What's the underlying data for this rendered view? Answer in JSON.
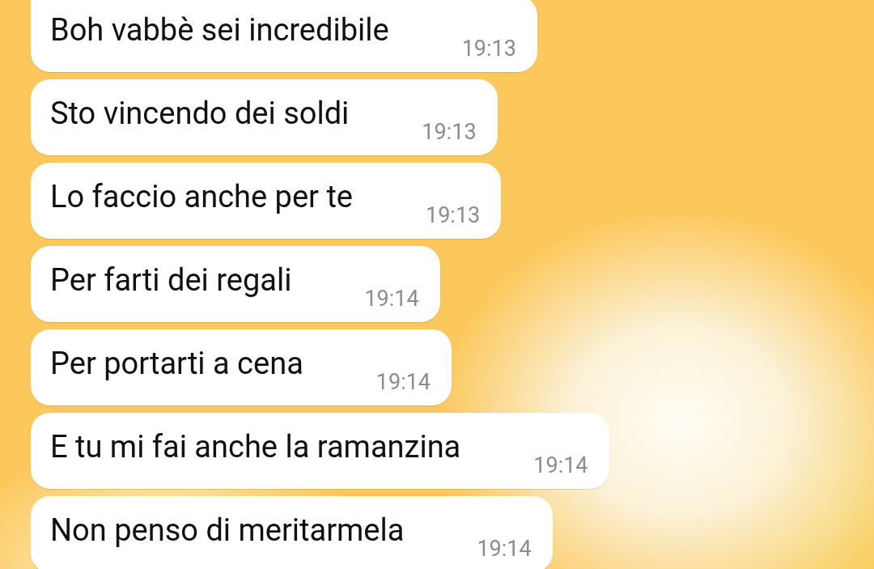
{
  "messages": [
    {
      "text": "Boh vabbè sei incredibile",
      "time": "19:13"
    },
    {
      "text": "Sto vincendo dei soldi",
      "time": "19:13"
    },
    {
      "text": "Lo faccio anche per te",
      "time": "19:13"
    },
    {
      "text": "Per farti dei regali",
      "time": "19:14"
    },
    {
      "text": "Per portarti a cena",
      "time": "19:14"
    },
    {
      "text": "E tu mi fai anche la ramanzina",
      "time": "19:14"
    },
    {
      "text": "Non penso di meritarmela",
      "time": "19:14"
    }
  ]
}
